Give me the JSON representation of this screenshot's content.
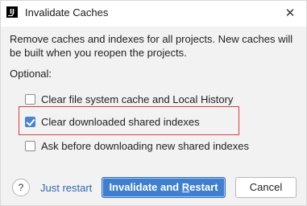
{
  "window": {
    "title": "Invalidate Caches",
    "app_icon_text": "IJ",
    "close_glyph": "✕"
  },
  "message": "Remove caches and indexes for all projects. New caches will be built when you reopen the projects.",
  "optional_label": "Optional:",
  "options": [
    {
      "label": "Clear file system cache and Local History",
      "checked": false
    },
    {
      "label": "Clear downloaded shared indexes",
      "checked": true
    },
    {
      "label": "Ask before downloading new shared indexes",
      "checked": false
    }
  ],
  "highlight": {
    "color": "#e03b3b",
    "target": "Clear downloaded shared indexes"
  },
  "footer": {
    "help_glyph": "?",
    "just_restart_label": "Just restart",
    "invalidate_label_prefix": "Invalidate and ",
    "invalidate_label_mnemonic": "R",
    "invalidate_label_suffix": "estart",
    "cancel_label": "Cancel"
  },
  "colors": {
    "accent": "#3f7fd0",
    "link": "#2f6ab3",
    "checkbox_checked": "#4a84d1"
  }
}
